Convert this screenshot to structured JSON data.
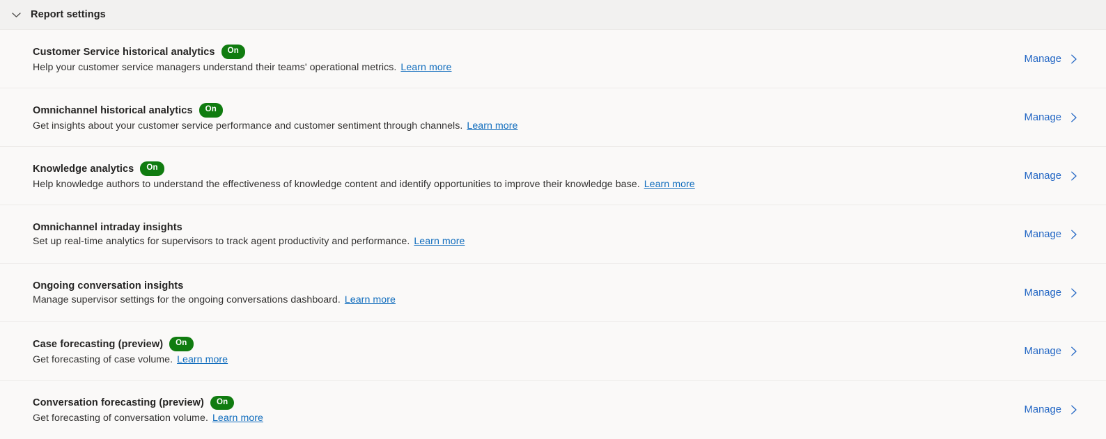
{
  "header": {
    "title": "Report settings",
    "collapse_icon": "chevron-down-icon"
  },
  "colors": {
    "header_background": "#f2f1f0",
    "page_background": "#faf9f8",
    "badge_on": "#107c10",
    "link_blue": "#0f6cbd",
    "manage_blue": "#2266c4",
    "divider": "#edebe9",
    "title_text": "#252423",
    "body_text": "#323130"
  },
  "common": {
    "learn_more_label": "Learn more",
    "manage_label": "Manage",
    "manage_chevron_icon": "chevron-right-icon",
    "badge_on_label": "On"
  },
  "settings": [
    {
      "title": "Customer Service historical analytics",
      "badge": "On",
      "description": "Help your customer service managers understand their teams' operational metrics.",
      "learn_more": "Learn more",
      "action": "Manage"
    },
    {
      "title": "Omnichannel historical analytics",
      "badge": "On",
      "description": "Get insights about your customer service performance and customer sentiment through channels.",
      "learn_more": "Learn more",
      "action": "Manage"
    },
    {
      "title": "Knowledge analytics",
      "badge": "On",
      "description": "Help knowledge authors to understand the effectiveness of knowledge content and identify opportunities to improve their knowledge base.",
      "learn_more": "Learn more",
      "action": "Manage"
    },
    {
      "title": "Omnichannel intraday insights",
      "badge": null,
      "description": "Set up real-time analytics for supervisors to track agent productivity and performance.",
      "learn_more": "Learn more",
      "action": "Manage"
    },
    {
      "title": "Ongoing conversation insights",
      "badge": null,
      "description": "Manage supervisor settings for the ongoing conversations dashboard.",
      "learn_more": "Learn more",
      "action": "Manage"
    },
    {
      "title": "Case forecasting (preview)",
      "badge": "On",
      "description": "Get forecasting of case volume.",
      "learn_more": "Learn more",
      "action": "Manage"
    },
    {
      "title": "Conversation forecasting (preview)",
      "badge": "On",
      "description": "Get forecasting of conversation volume.",
      "learn_more": "Learn more",
      "action": "Manage"
    }
  ]
}
